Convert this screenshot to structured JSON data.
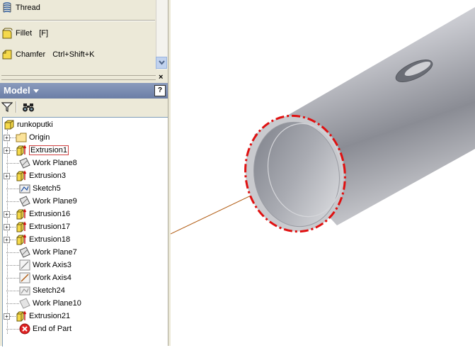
{
  "tools": [
    {
      "label": "Thread",
      "shortcut": ""
    },
    {
      "label": "Fillet",
      "shortcut": "[F]"
    },
    {
      "label": "Chamfer",
      "shortcut": "Ctrl+Shift+K"
    }
  ],
  "panel": {
    "title": "Model",
    "help_label": "?",
    "close_label": "×"
  },
  "tree": {
    "root": "runkoputki",
    "items": [
      {
        "label": "Origin",
        "icon": "folder-icon"
      },
      {
        "label": "Extrusion1",
        "icon": "extrusion-icon"
      },
      {
        "label": "Work Plane8",
        "icon": "work-plane-icon"
      },
      {
        "label": "Extrusion3",
        "icon": "extrusion-icon"
      },
      {
        "label": "Sketch5",
        "icon": "sketch-icon"
      },
      {
        "label": "Work Plane9",
        "icon": "work-plane-icon"
      },
      {
        "label": "Extrusion16",
        "icon": "extrusion-icon"
      },
      {
        "label": "Extrusion17",
        "icon": "extrusion-icon"
      },
      {
        "label": "Extrusion18",
        "icon": "extrusion-icon"
      },
      {
        "label": "Work Plane7",
        "icon": "work-plane-icon"
      },
      {
        "label": "Work Axis3",
        "icon": "work-axis-icon"
      },
      {
        "label": "Work Axis4",
        "icon": "work-axis-icon"
      },
      {
        "label": "Sketch24",
        "icon": "sketch-icon"
      },
      {
        "label": "Work Plane10",
        "icon": "work-plane-icon"
      },
      {
        "label": "Extrusion21",
        "icon": "extrusion-icon"
      },
      {
        "label": "End of Part",
        "icon": "end-of-part-icon"
      }
    ],
    "selected": "Extrusion1"
  },
  "colors": {
    "highlight": "#e01010",
    "axis_line": "#b05a10",
    "header": "#6b7ea6"
  }
}
